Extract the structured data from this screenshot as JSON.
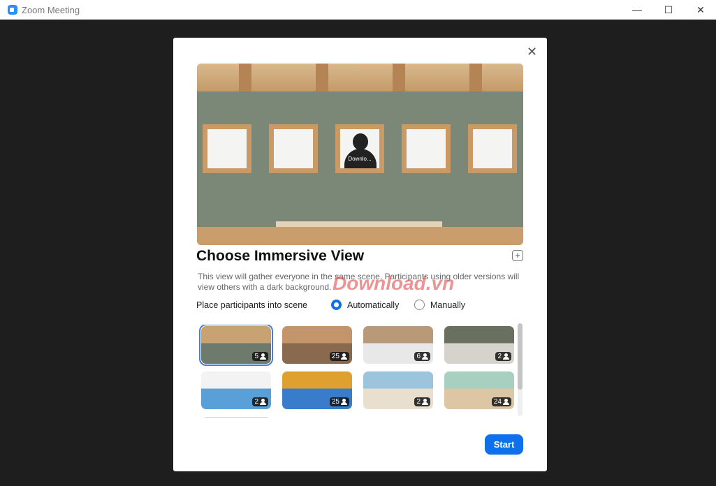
{
  "window": {
    "title": "Zoom Meeting",
    "minimize": "—",
    "maximize": "☐",
    "close": "✕"
  },
  "dialog": {
    "close_icon": "✕",
    "preview": {
      "participant_name": "Downlo..."
    },
    "title": "Choose Immersive View",
    "add_icon": "+",
    "description": "This view will gather everyone in the same scene. Participants using older versions will view others with a dark background.",
    "watermark": "Download.vn",
    "place_label": "Place participants into scene",
    "options": [
      {
        "label": "Automatically",
        "selected": true
      },
      {
        "label": "Manually",
        "selected": false
      }
    ],
    "scenes": [
      {
        "count": "5",
        "selected": true,
        "colors": [
          "#c9a274",
          "#6e7b6c"
        ]
      },
      {
        "count": "25",
        "colors": [
          "#c4956a",
          "#8a6a4e"
        ]
      },
      {
        "count": "6",
        "colors": [
          "#b89a78",
          "#e8e8e8"
        ]
      },
      {
        "count": "2",
        "colors": [
          "#6a7060",
          "#d6d3cc"
        ]
      },
      {
        "count": "2",
        "colors": [
          "#f3f3f3",
          "#5aa0d8"
        ]
      },
      {
        "count": "25",
        "colors": [
          "#e0a030",
          "#3a7ccc"
        ]
      },
      {
        "count": "2",
        "colors": [
          "#9cc4dc",
          "#e8dfcf"
        ]
      },
      {
        "count": "24",
        "colors": [
          "#a8d0c0",
          "#dcc6a4"
        ]
      }
    ],
    "start_label": "Start",
    "accent": "#0e71eb"
  }
}
